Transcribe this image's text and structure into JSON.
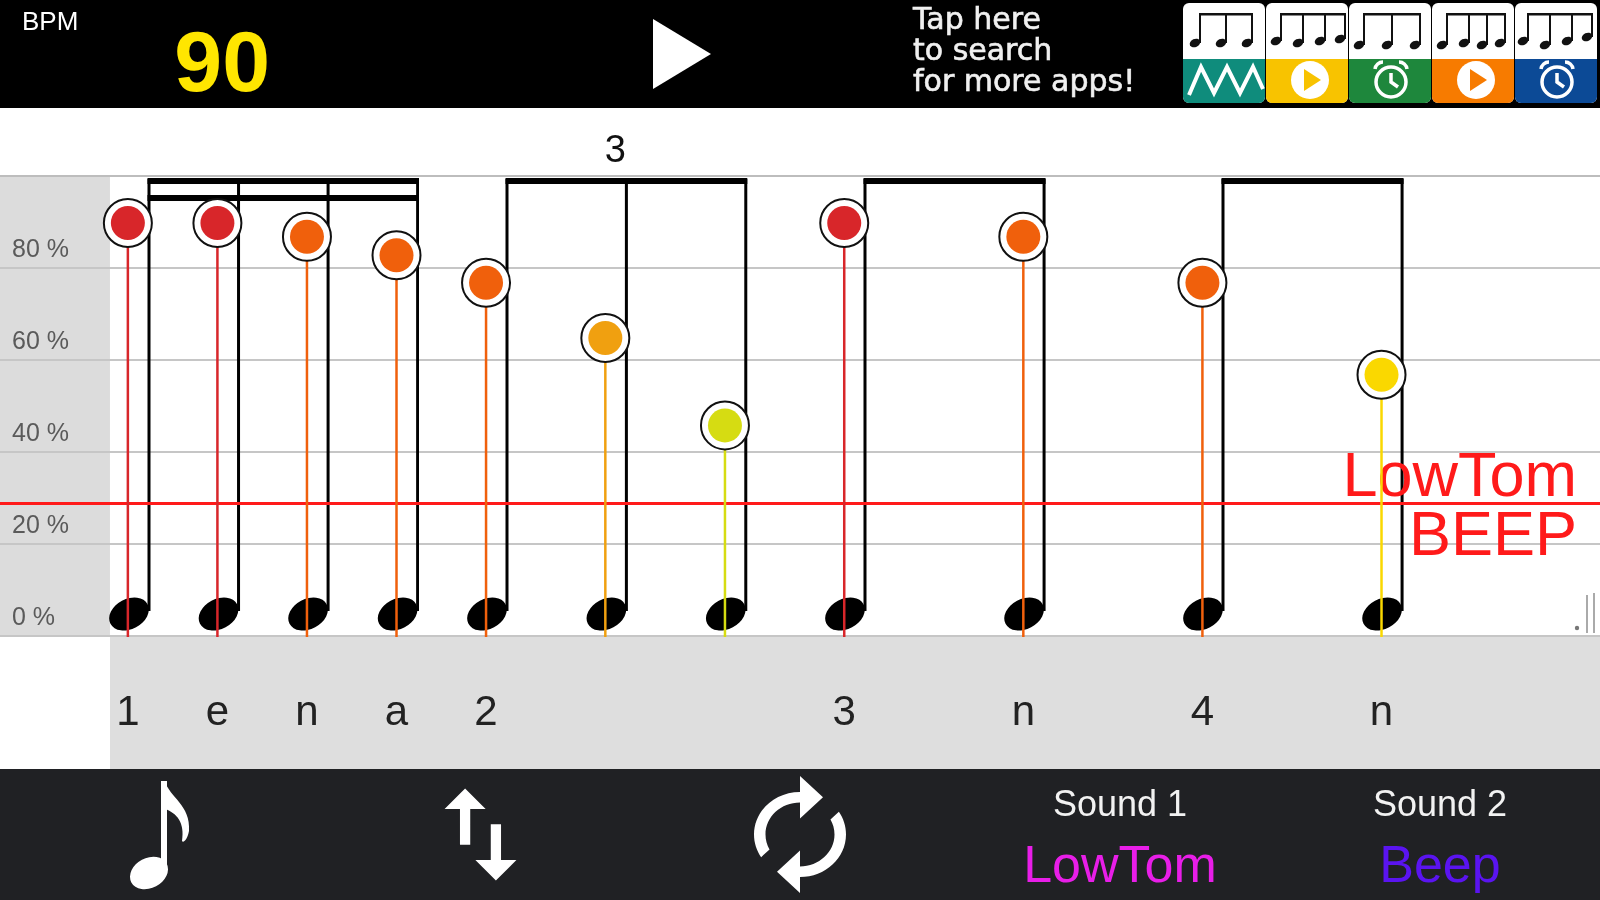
{
  "top_bar": {
    "bpm_label": "BPM",
    "bpm_value": "90",
    "playing": false,
    "promo_lines": [
      "Tap here",
      "to search",
      "for more apps!"
    ],
    "promo_apps": [
      {
        "kind": "wave",
        "color": "#0f8c7c"
      },
      {
        "kind": "play",
        "color": "#f8c300"
      },
      {
        "kind": "alarm",
        "color": "#1e873c"
      },
      {
        "kind": "play",
        "color": "#f77b00"
      },
      {
        "kind": "alarm",
        "color": "#0c4a96"
      }
    ]
  },
  "score": {
    "beats": [
      {
        "kind": "sixteenths"
      },
      {
        "kind": "triplet",
        "tuplet": "3"
      },
      {
        "kind": "eighths"
      },
      {
        "kind": "eighths"
      }
    ],
    "chart_data": [
      {
        "type": "lollipop",
        "x": [
          1,
          1.25,
          1.5,
          1.75,
          2,
          2.333,
          2.667,
          3,
          3.5,
          4,
          4.5
        ],
        "values": [
          90,
          90,
          87,
          83,
          77,
          65,
          46,
          90,
          87,
          77,
          57
        ],
        "colors": [
          "#d8262a",
          "#d8262a",
          "#f0600c",
          "#f0600c",
          "#f0600c",
          "#f0a010",
          "#d6dc12",
          "#d8262a",
          "#f0600c",
          "#f0600c",
          "#fad800"
        ],
        "xticks": [
          {
            "value": 1,
            "label": "1"
          },
          {
            "value": 1.25,
            "label": "e"
          },
          {
            "value": 1.5,
            "label": "n"
          },
          {
            "value": 1.75,
            "label": "a"
          },
          {
            "value": 2,
            "label": "2"
          },
          {
            "value": 3,
            "label": "3"
          },
          {
            "value": 3.5,
            "label": "n"
          },
          {
            "value": 4,
            "label": "4"
          },
          {
            "value": 4.5,
            "label": "n"
          }
        ],
        "yticks": [
          {
            "value": 0,
            "label": "0 %"
          },
          {
            "value": 20,
            "label": "20 %"
          },
          {
            "value": 40,
            "label": "40 %"
          },
          {
            "value": 60,
            "label": "60 %"
          },
          {
            "value": 80,
            "label": "80 %"
          }
        ],
        "xlim": [
          0.643,
          5.11
        ],
        "ylim": [
          0,
          100
        ],
        "grid": true,
        "bands": [
          {
            "axis": "x",
            "from": 0.643,
            "to": 0.95,
            "color": "#dcdcdc"
          }
        ],
        "ref_lines": [
          {
            "axis": "y",
            "value": 29,
            "color": "#ff1a1a"
          }
        ],
        "annotations": [
          "LowTom",
          "BEEP"
        ]
      }
    ]
  },
  "toolbar": {
    "tools": [
      {
        "kind": "note"
      },
      {
        "kind": "swap"
      },
      {
        "kind": "repeat"
      }
    ],
    "sounds": [
      {
        "label": "Sound 1",
        "value": "LowTom",
        "color": "#e81ee8"
      },
      {
        "label": "Sound 2",
        "value": "Beep",
        "color": "#5a14f0"
      }
    ]
  }
}
